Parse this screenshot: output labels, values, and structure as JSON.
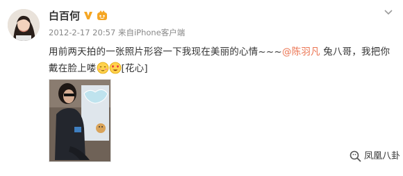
{
  "post": {
    "user": {
      "name": "白百何",
      "verified_icon": "verified-v-badge-icon",
      "vip_icon": "vip-member-icon"
    },
    "meta": {
      "timestamp": "2012-2-17 20:57",
      "source_prefix": "来自",
      "source": "iPhone客户端"
    },
    "text": {
      "before_mention": "用前两天拍的一张照片形容一下我现在美丽的心情~~~",
      "mention": "@陈羽凡",
      "after_mention": " 兔八哥，我把你戴在脸上喽",
      "emoji_tag": "[花心]"
    },
    "emojis": [
      "shy-face-emoji",
      "heart-eyes-face-emoji"
    ],
    "menu_icon": "chevron-down-icon"
  },
  "watermark": {
    "icon": "wechat-search-icon",
    "text": "凤凰八卦"
  },
  "colors": {
    "mention": "#eb7350",
    "meta": "#888888",
    "text": "#333333",
    "verified": "#f5a623"
  }
}
